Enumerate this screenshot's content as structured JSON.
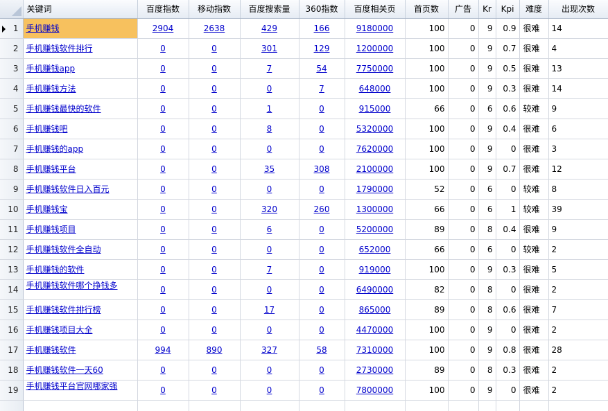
{
  "columns": [
    "关键词",
    "百度指数",
    "移动指数",
    "百度搜索量",
    "360指数",
    "百度相关页",
    "首页数",
    "广告",
    "Kr",
    "Kpi",
    "难度",
    "出现次数"
  ],
  "rows": [
    {
      "n": "1",
      "kw": "手机赚钱",
      "bd": "2904",
      "mb": "2638",
      "sv": "429",
      "s360": "166",
      "rel": "9180000",
      "home": "100",
      "ad": "0",
      "kr": "9",
      "kpi": "0.9",
      "diff": "很难",
      "cnt": "14"
    },
    {
      "n": "2",
      "kw": "手机赚钱软件排行",
      "bd": "0",
      "mb": "0",
      "sv": "301",
      "s360": "129",
      "rel": "1200000",
      "home": "100",
      "ad": "0",
      "kr": "9",
      "kpi": "0.7",
      "diff": "很难",
      "cnt": "4"
    },
    {
      "n": "3",
      "kw": "手机赚钱app",
      "bd": "0",
      "mb": "0",
      "sv": "7",
      "s360": "54",
      "rel": "7750000",
      "home": "100",
      "ad": "0",
      "kr": "9",
      "kpi": "0.5",
      "diff": "很难",
      "cnt": "13"
    },
    {
      "n": "4",
      "kw": "手机赚钱方法",
      "bd": "0",
      "mb": "0",
      "sv": "0",
      "s360": "7",
      "rel": "648000",
      "home": "100",
      "ad": "0",
      "kr": "9",
      "kpi": "0.3",
      "diff": "很难",
      "cnt": "14"
    },
    {
      "n": "5",
      "kw": "手机赚钱最快的软件",
      "bd": "0",
      "mb": "0",
      "sv": "1",
      "s360": "0",
      "rel": "915000",
      "home": "66",
      "ad": "0",
      "kr": "6",
      "kpi": "0.6",
      "diff": "较难",
      "cnt": "9"
    },
    {
      "n": "6",
      "kw": "手机赚钱吧",
      "bd": "0",
      "mb": "0",
      "sv": "8",
      "s360": "0",
      "rel": "5320000",
      "home": "100",
      "ad": "0",
      "kr": "9",
      "kpi": "0.4",
      "diff": "很难",
      "cnt": "6"
    },
    {
      "n": "7",
      "kw": "手机赚钱的app",
      "bd": "0",
      "mb": "0",
      "sv": "0",
      "s360": "0",
      "rel": "7620000",
      "home": "100",
      "ad": "0",
      "kr": "9",
      "kpi": "0",
      "diff": "很难",
      "cnt": "3"
    },
    {
      "n": "8",
      "kw": "手机赚钱平台",
      "bd": "0",
      "mb": "0",
      "sv": "35",
      "s360": "308",
      "rel": "2100000",
      "home": "100",
      "ad": "0",
      "kr": "9",
      "kpi": "0.7",
      "diff": "很难",
      "cnt": "12"
    },
    {
      "n": "9",
      "kw": "手机赚钱软件日入百元",
      "bd": "0",
      "mb": "0",
      "sv": "0",
      "s360": "0",
      "rel": "1790000",
      "home": "52",
      "ad": "0",
      "kr": "6",
      "kpi": "0",
      "diff": "较难",
      "cnt": "8"
    },
    {
      "n": "10",
      "kw": "手机赚钱宝",
      "bd": "0",
      "mb": "0",
      "sv": "320",
      "s360": "260",
      "rel": "1300000",
      "home": "66",
      "ad": "0",
      "kr": "6",
      "kpi": "1",
      "diff": "较难",
      "cnt": "39"
    },
    {
      "n": "11",
      "kw": "手机赚钱项目",
      "bd": "0",
      "mb": "0",
      "sv": "6",
      "s360": "0",
      "rel": "5200000",
      "home": "89",
      "ad": "0",
      "kr": "8",
      "kpi": "0.4",
      "diff": "很难",
      "cnt": "9"
    },
    {
      "n": "12",
      "kw": "手机赚钱软件全自动",
      "bd": "0",
      "mb": "0",
      "sv": "0",
      "s360": "0",
      "rel": "652000",
      "home": "66",
      "ad": "0",
      "kr": "6",
      "kpi": "0",
      "diff": "较难",
      "cnt": "2"
    },
    {
      "n": "13",
      "kw": "手机赚钱的软件",
      "bd": "0",
      "mb": "0",
      "sv": "7",
      "s360": "0",
      "rel": "919000",
      "home": "100",
      "ad": "0",
      "kr": "9",
      "kpi": "0.3",
      "diff": "很难",
      "cnt": "5"
    },
    {
      "n": "14",
      "kw": "手机赚钱软件哪个挣钱多",
      "bd": "0",
      "mb": "0",
      "sv": "0",
      "s360": "0",
      "rel": "6490000",
      "home": "82",
      "ad": "0",
      "kr": "8",
      "kpi": "0",
      "diff": "很难",
      "cnt": "2"
    },
    {
      "n": "15",
      "kw": "手机赚钱软件排行榜",
      "bd": "0",
      "mb": "0",
      "sv": "17",
      "s360": "0",
      "rel": "865000",
      "home": "89",
      "ad": "0",
      "kr": "8",
      "kpi": "0.6",
      "diff": "很难",
      "cnt": "7"
    },
    {
      "n": "16",
      "kw": "手机赚钱项目大全",
      "bd": "0",
      "mb": "0",
      "sv": "0",
      "s360": "0",
      "rel": "4470000",
      "home": "100",
      "ad": "0",
      "kr": "9",
      "kpi": "0",
      "diff": "很难",
      "cnt": "2"
    },
    {
      "n": "17",
      "kw": "手机赚钱软件",
      "bd": "994",
      "mb": "890",
      "sv": "327",
      "s360": "58",
      "rel": "7310000",
      "home": "100",
      "ad": "0",
      "kr": "9",
      "kpi": "0.8",
      "diff": "很难",
      "cnt": "28"
    },
    {
      "n": "18",
      "kw": "手机赚钱软件一天60",
      "bd": "0",
      "mb": "0",
      "sv": "0",
      "s360": "0",
      "rel": "2730000",
      "home": "89",
      "ad": "0",
      "kr": "8",
      "kpi": "0.3",
      "diff": "很难",
      "cnt": "2"
    },
    {
      "n": "19",
      "kw": "手机赚钱平台官网哪家强",
      "bd": "0",
      "mb": "0",
      "sv": "0",
      "s360": "0",
      "rel": "7800000",
      "home": "100",
      "ad": "0",
      "kr": "9",
      "kpi": "0",
      "diff": "很难",
      "cnt": "2"
    },
    {
      "n": "",
      "kw": "",
      "bd": "",
      "mb": "",
      "sv": "",
      "s360": "",
      "rel": "",
      "home": "",
      "ad": "",
      "kr": "",
      "kpi": "",
      "diff": "",
      "cnt": ""
    }
  ]
}
